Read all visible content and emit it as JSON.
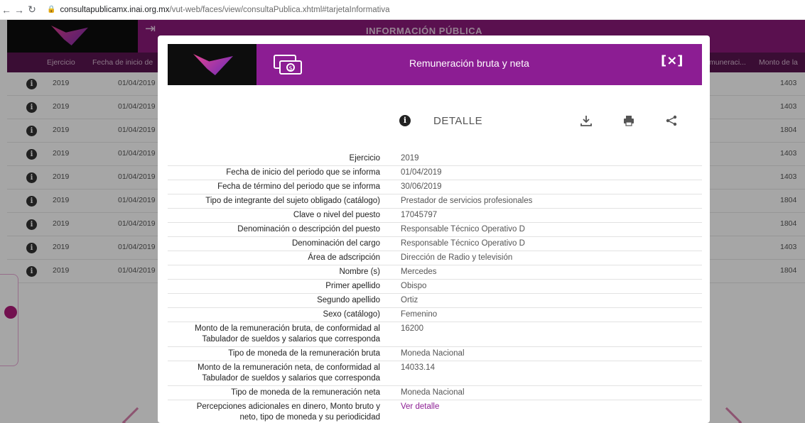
{
  "browser": {
    "url_host": "consultapublicamx.inai.org.mx",
    "url_path": "/vut-web/faces/view/consultaPublica.xhtml#tarjetaInformativa"
  },
  "background": {
    "header_title": "INFORMACIÓN PÚBLICA",
    "columns": [
      "Ejercicio",
      "Fecha de inicio de",
      "muneraci...",
      "Monto de la"
    ],
    "rows": [
      {
        "year": "2019",
        "date": "01/04/2019",
        "amount": "1403"
      },
      {
        "year": "2019",
        "date": "01/04/2019",
        "amount": "1403"
      },
      {
        "year": "2019",
        "date": "01/04/2019",
        "amount": "1804"
      },
      {
        "year": "2019",
        "date": "01/04/2019",
        "amount": "1403"
      },
      {
        "year": "2019",
        "date": "01/04/2019",
        "amount": "1403"
      },
      {
        "year": "2019",
        "date": "01/04/2019",
        "amount": "1804"
      },
      {
        "year": "2019",
        "date": "01/04/2019",
        "amount": "1804"
      },
      {
        "year": "2019",
        "date": "01/04/2019",
        "amount": "1403"
      },
      {
        "year": "2019",
        "date": "01/04/2019",
        "amount": "1804"
      }
    ]
  },
  "modal": {
    "title": "Remuneración bruta y neta",
    "close_label": "[×]",
    "detail_label": "DETALLE",
    "fields": [
      {
        "label": "Ejercicio",
        "value": "2019"
      },
      {
        "label": "Fecha de inicio del periodo que se informa",
        "value": "01/04/2019"
      },
      {
        "label": "Fecha de término del periodo que se informa",
        "value": "30/06/2019"
      },
      {
        "label": "Tipo de integrante del sujeto obligado (catálogo)",
        "value": "Prestador de servicios profesionales"
      },
      {
        "label": "Clave o nivel del puesto",
        "value": "17045797"
      },
      {
        "label": "Denominación o descripción del puesto",
        "value": "Responsable Técnico Operativo D"
      },
      {
        "label": "Denominación del cargo",
        "value": "Responsable Técnico Operativo D"
      },
      {
        "label": "Área de adscripción",
        "value": "Dirección de Radio y televisión"
      },
      {
        "label": "Nombre (s)",
        "value": "Mercedes"
      },
      {
        "label": "Primer apellido",
        "value": "Obispo"
      },
      {
        "label": "Segundo apellido",
        "value": "Ortiz"
      },
      {
        "label": "Sexo (catálogo)",
        "value": "Femenino"
      },
      {
        "label": "Monto de la remuneración bruta, de conformidad al Tabulador de sueldos y salarios que corresponda",
        "value": "16200"
      },
      {
        "label": "Tipo de moneda de la remuneración bruta",
        "value": "Moneda Nacional"
      },
      {
        "label": "Monto de la remuneración neta, de conformidad al Tabulador de sueldos y salarios que corresponda",
        "value": "14033.14"
      },
      {
        "label": "Tipo de moneda de la remuneración neta",
        "value": "Moneda Nacional"
      },
      {
        "label": "Percepciones adicionales en dinero, Monto bruto y neto, tipo de moneda y su periodicidad",
        "value": "Ver detalle",
        "link": true
      }
    ]
  },
  "colors": {
    "brand_purple": "#8c1d93",
    "header_dark_purple": "#5a1450"
  }
}
